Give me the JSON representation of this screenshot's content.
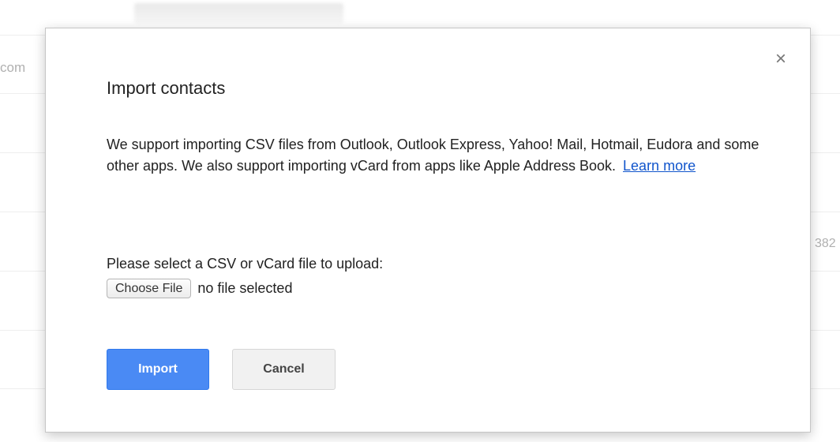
{
  "background": {
    "left_text": "com",
    "right_text": "382"
  },
  "dialog": {
    "close_symbol": "×",
    "title": "Import contacts",
    "description": "We support importing CSV files from Outlook, Outlook Express, Yahoo! Mail, Hotmail, Eudora and some other apps. We also support importing vCard from apps like Apple Address Book.",
    "learn_more_label": "Learn more",
    "select_label": "Please select a CSV or vCard file to upload:",
    "choose_file_label": "Choose File",
    "file_status": "no file selected",
    "import_label": "Import",
    "cancel_label": "Cancel"
  },
  "colors": {
    "primary_button": "#4a8af4",
    "link": "#1155cc",
    "cancel_button": "#f1f1f1"
  },
  "icons": {
    "close": "close-icon"
  }
}
